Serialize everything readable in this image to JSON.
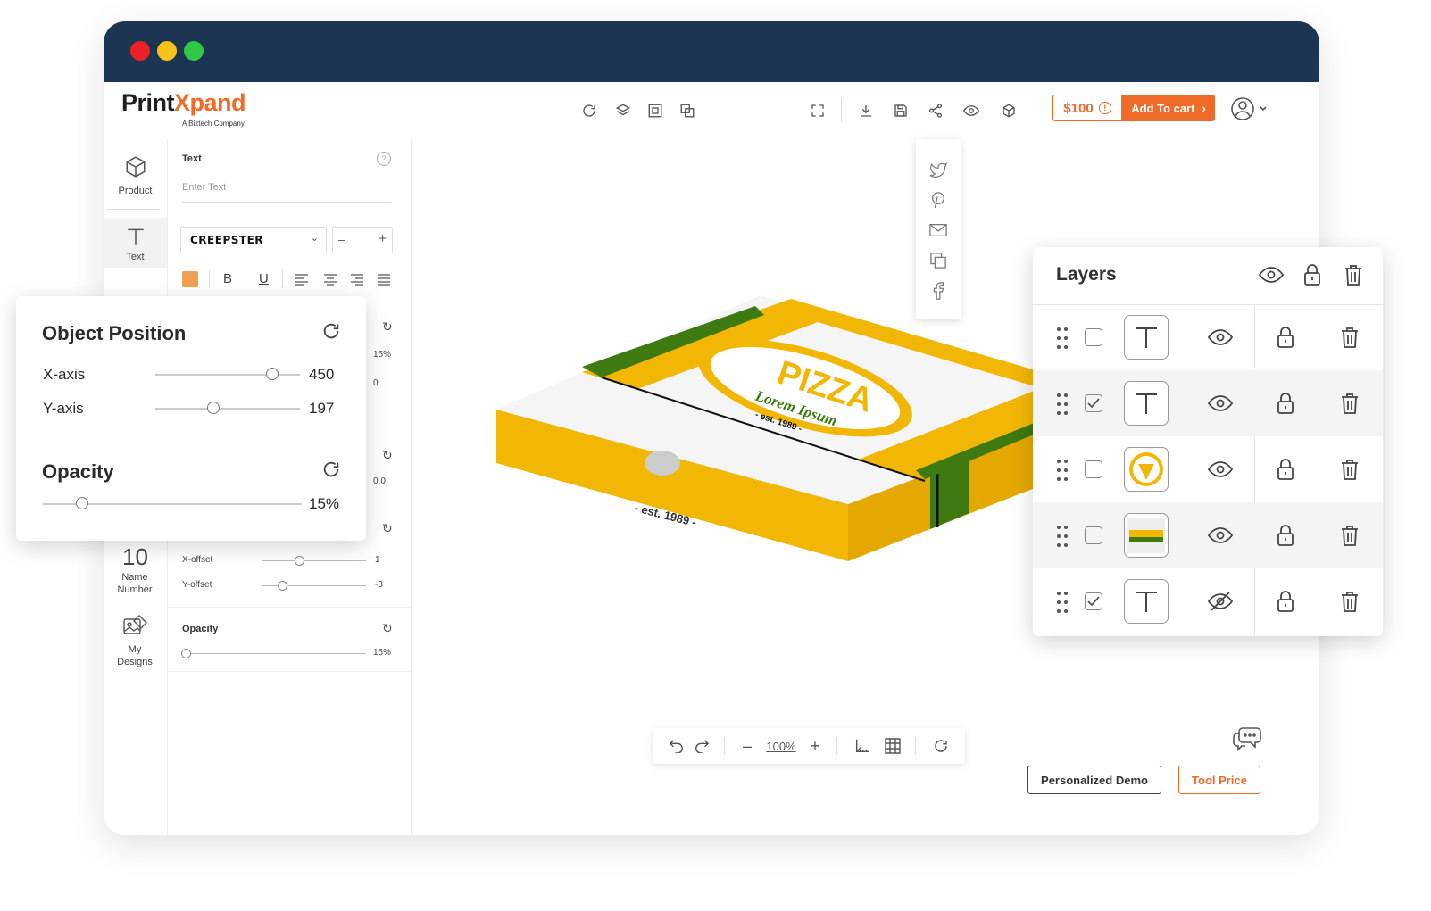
{
  "window": {
    "dots": {
      "red": "#ee2027",
      "yellow": "#f7c21a",
      "green": "#2fc743"
    },
    "titlebar_color": "#1b3553"
  },
  "brand": {
    "logo_pre": "Print",
    "logo_x": "X",
    "logo_post": "pand",
    "tagline": "A Biztech Company",
    "accent": "#f06a28"
  },
  "topbar": {
    "icons": [
      "refresh-icon",
      "layers-stack-icon",
      "duplicate-icon",
      "arrange-icon",
      "fullscreen-icon",
      "download-icon",
      "save-icon",
      "share-icon",
      "preview-icon",
      "3d-view-icon"
    ],
    "price": "$100",
    "add_to_cart": "Add To cart"
  },
  "share_menu": [
    "twitter-icon",
    "pinterest-icon",
    "email-icon",
    "copy-link-icon",
    "facebook-icon"
  ],
  "sidebar": {
    "items": [
      {
        "label": "Product",
        "icon": "cube-icon"
      },
      {
        "label": "Text",
        "icon": "text-icon"
      },
      {
        "label": "10",
        "icon": "name-number-icon"
      },
      {
        "label": "Name Number"
      },
      {
        "label": "My Designs",
        "icon": "my-designs-icon"
      }
    ]
  },
  "text_panel": {
    "section_title": "Text",
    "input_placeholder": "Enter Text",
    "font_name": "CREEPSTER",
    "size_minus": "–",
    "size_plus": "+",
    "color_swatch": "#f0a052",
    "bold": "B",
    "underline": "U",
    "partial_value_1": "15%",
    "partial_value_2": "0",
    "partial_value_3": "0.0",
    "x_offset_label": "X-offset",
    "x_offset_value": "1",
    "x_offset_level": 0.36,
    "y_offset_label": "Y-offset",
    "y_offset_value": "-3",
    "y_offset_level": 0.19,
    "opacity_title": "Opacity",
    "opacity_value": "15%",
    "opacity_level": 0.0
  },
  "object_position": {
    "title": "Object Position",
    "x_label": "X-axis",
    "x_value": "450",
    "x_level": 0.81,
    "y_label": "Y-axis",
    "y_value": "197",
    "y_level": 0.4,
    "opacity_title": "Opacity",
    "opacity_value": "15%",
    "opacity_level": 0.15
  },
  "canvas": {
    "box_text_brand": "PIZZA",
    "box_text_lorem": "Lorem Ipsum",
    "box_text_est": "- est. 1989 -",
    "box_side_text": "- est. 1989 -",
    "colors": {
      "yellow": "#f2b705",
      "green": "#3d7a0f",
      "box_white": "#f5f5f5"
    }
  },
  "layers": {
    "title": "Layers",
    "rows": [
      {
        "checked": false,
        "thumb": "text",
        "visible": true
      },
      {
        "checked": true,
        "thumb": "text",
        "visible": true
      },
      {
        "checked": false,
        "thumb": "pizza-logo",
        "visible": true
      },
      {
        "checked": false,
        "thumb": "stripe",
        "visible": true
      },
      {
        "checked": true,
        "thumb": "text",
        "visible": false
      }
    ]
  },
  "bottom_toolbar": {
    "zoom": "100%"
  },
  "buttons": {
    "demo": "Personalized Demo",
    "tool_price": "Tool Price"
  }
}
